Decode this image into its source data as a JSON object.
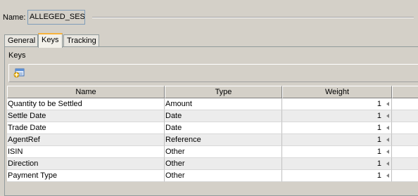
{
  "header": {
    "name_label": "Name:",
    "name_value": "ALLEGED_SESE"
  },
  "tabs": [
    {
      "label": "General",
      "active": false
    },
    {
      "label": "Keys",
      "active": true
    },
    {
      "label": "Tracking",
      "active": false
    }
  ],
  "panel": {
    "title": "Keys",
    "toolbar": {
      "add_icon": "add-key-icon"
    }
  },
  "table": {
    "columns": [
      "Name",
      "Type",
      "Weight"
    ],
    "rows": [
      {
        "name": "Quantity to be Settled",
        "type": "Amount",
        "weight": "1"
      },
      {
        "name": "Settle Date",
        "type": "Date",
        "weight": "1"
      },
      {
        "name": "Trade Date",
        "type": "Date",
        "weight": "1"
      },
      {
        "name": "AgentRef",
        "type": "Reference",
        "weight": "1"
      },
      {
        "name": "ISIN",
        "type": "Other",
        "weight": "1"
      },
      {
        "name": "Direction",
        "type": "Other",
        "weight": "1"
      },
      {
        "name": "Payment Type",
        "type": "Other",
        "weight": "1"
      }
    ]
  },
  "colors": {
    "background": "#d4d0c8",
    "active_tab_accent": "#f7b23b",
    "alt_row": "#ececec"
  }
}
